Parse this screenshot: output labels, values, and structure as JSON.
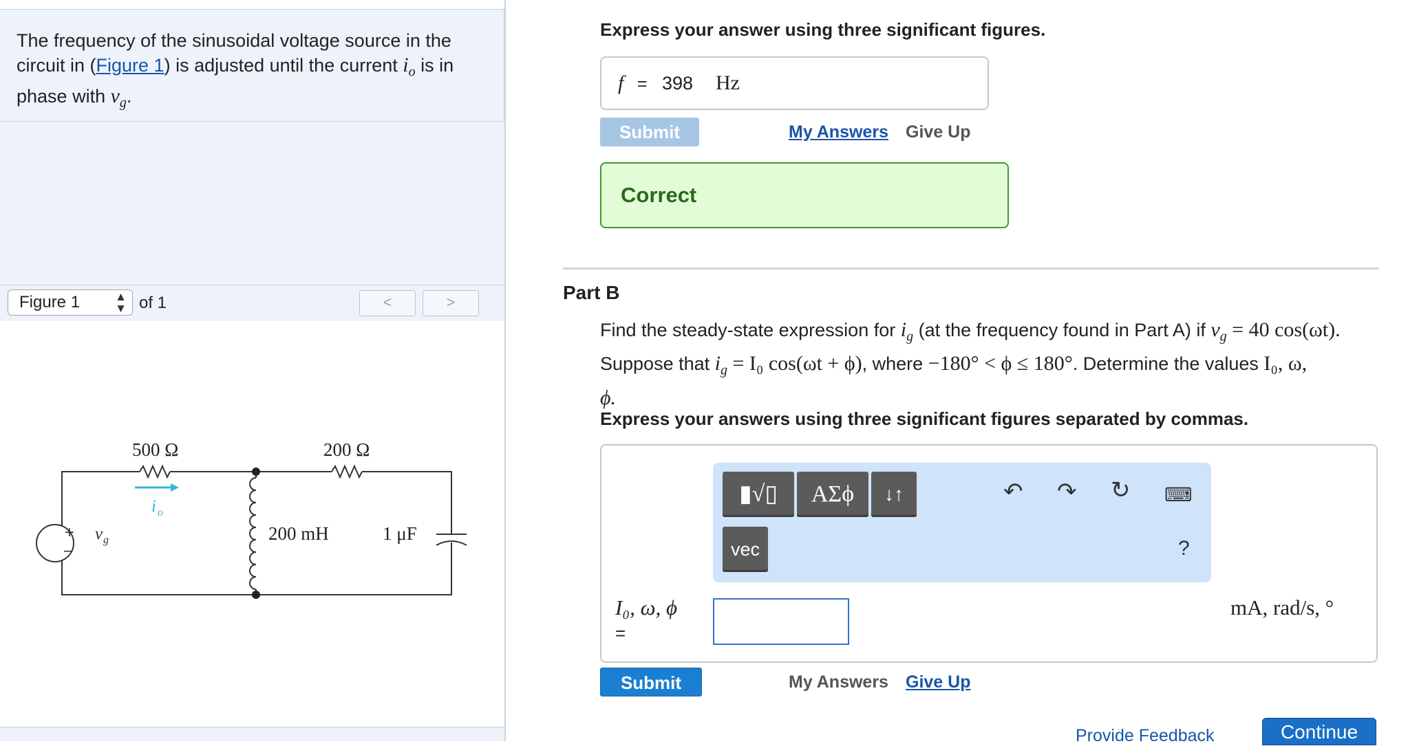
{
  "problem": {
    "text_before": "The frequency of the sinusoidal voltage source in the circuit in (",
    "figure_link": "Figure 1",
    "text_middle": ") is adjusted until the current ",
    "current_symbol": "i",
    "current_sub": "o",
    "text_after": " is in phase with ",
    "voltage_symbol": "v",
    "voltage_sub": "g",
    "period": "."
  },
  "figure_nav": {
    "selected": "Figure 1",
    "of_label": "of 1",
    "prev_glyph": "<",
    "next_glyph": ">"
  },
  "circuit": {
    "r1_label": "500 Ω",
    "r2_label": "200 Ω",
    "inductor_label": "200 mH",
    "capacitor_label": "1 μF",
    "current_symbol": "i",
    "current_sub": "o",
    "source_symbol": "v",
    "source_sub": "g",
    "plus": "+",
    "minus": "−"
  },
  "part_a": {
    "instruction": "Express your answer using three significant figures.",
    "answer_label": "f",
    "answer_eq": "=",
    "answer_value": "398",
    "answer_unit": "Hz",
    "submit_label": "Submit",
    "my_answers_label": "My Answers",
    "give_up_label": "Give Up",
    "feedback": "Correct"
  },
  "part_b": {
    "title": "Part B",
    "line1_a": "Find the steady-state expression for ",
    "line1_b": " (at the frequency found in Part A) if ",
    "line1_vg_eq": " = 40 cos(ωt).",
    "line2_a": "Suppose that ",
    "line2_eq": " = I₀ cos(ωt + ϕ)",
    "line2_b": ", where ",
    "line2_range": "−180° < ϕ ≤ 180°",
    "line2_c": ". Determine the values ",
    "line2_vals": "I₀, ω,",
    "line3": "ϕ.",
    "ig_symbol": "i",
    "ig_sub": "g",
    "vg_symbol": "v",
    "vg_sub": "g",
    "instruction": "Express your answers using three significant figures separated by commas.",
    "toolbar": {
      "templates_label": "▮√▯",
      "greek_label": "ΑΣϕ",
      "arrows_label": "↓↑",
      "vec_label": "vec",
      "help_label": "?"
    },
    "input_label": "I₀, ω, ϕ",
    "input_eq": "=",
    "units": "mA, rad/s, °",
    "submit_label": "Submit",
    "my_answers_label": "My Answers",
    "give_up_label": "Give Up"
  },
  "footer": {
    "provide_feedback": "Provide Feedback",
    "continue_label": "Continue"
  }
}
